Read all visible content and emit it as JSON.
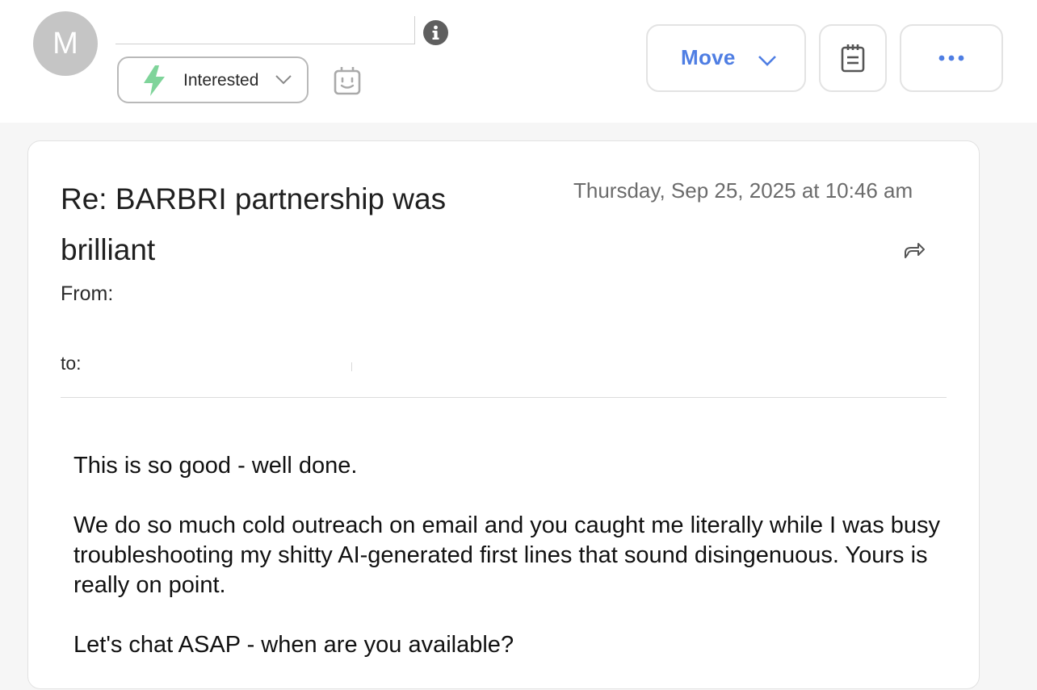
{
  "header": {
    "avatar_initial": "M",
    "status": {
      "label": "Interested",
      "icon": "lightning-bolt-icon",
      "icon_color": "#7fd49a"
    },
    "move_label": "Move",
    "accent_color": "#4f7ee3"
  },
  "email": {
    "subject": "Re: BARBRI partnership was brilliant",
    "date": "Thursday, Sep 25, 2025 at 10:46 am",
    "from_label": "From:",
    "to_label": "to:",
    "body": [
      "This is so good - well done.",
      "We do so much cold outreach on email and you caught me literally while I was busy troubleshooting my shitty AI-generated first lines that sound disingenuous. Yours is really on point.",
      "Let's chat ASAP - when are you available?"
    ]
  }
}
